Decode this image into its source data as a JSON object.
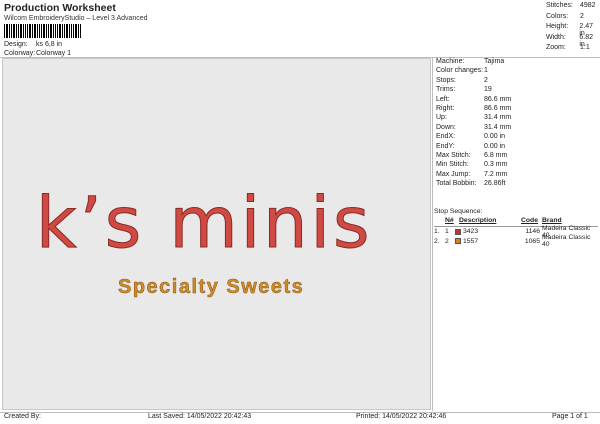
{
  "header": {
    "title": "Production Worksheet",
    "subtitle": "Wilcom EmbroideryStudio – Level 3 Advanced"
  },
  "design_info": {
    "design_label": "Design:",
    "design_value": "ks 6,8 in",
    "colorway_label": "Colorway:",
    "colorway_value": "Colorway 1"
  },
  "stats": [
    {
      "label": "Stitches:",
      "value": "4982"
    },
    {
      "label": "Colors:",
      "value": "2"
    },
    {
      "label": "Height:",
      "value": "2.47 in"
    },
    {
      "label": "Width:",
      "value": "6.82 in"
    },
    {
      "label": "Zoom:",
      "value": "1:1"
    }
  ],
  "machine": [
    {
      "label": "Machine:",
      "value": "Tajima"
    },
    {
      "label": "Color changes:",
      "value": "1"
    },
    {
      "label": "Stops:",
      "value": "2"
    },
    {
      "label": "Trims:",
      "value": "19"
    },
    {
      "label": "Left:",
      "value": "86.6 mm"
    },
    {
      "label": "Right:",
      "value": "86.6 mm"
    },
    {
      "label": "Up:",
      "value": "31.4 mm"
    },
    {
      "label": "Down:",
      "value": "31.4 mm"
    },
    {
      "label": "EndX:",
      "value": "0.00 in"
    },
    {
      "label": "EndY:",
      "value": "0.00 in"
    },
    {
      "label": "Max Stitch:",
      "value": "6.8 mm"
    },
    {
      "label": "Min Stitch:",
      "value": "0.3 mm"
    },
    {
      "label": "Max Jump:",
      "value": "7.2 mm"
    },
    {
      "label": "Total Bobbin:",
      "value": "26.86ft"
    }
  ],
  "stop_sequence": {
    "title": "Stop Sequence:",
    "headers": [
      "",
      "N#",
      "Description",
      "Code",
      "Brand"
    ],
    "rows": [
      {
        "stop": "1.",
        "n": "1",
        "color": "#c9302c",
        "description": "3423",
        "code": "1146",
        "brand": "Madeira Classic 40"
      },
      {
        "stop": "2.",
        "n": "2",
        "color": "#e07b1c",
        "description": "1557",
        "code": "1065",
        "brand": "Madeira Classic 40"
      }
    ]
  },
  "design": {
    "main_text": "k’s minis",
    "sub_text": "Specialty Sweets",
    "main_color": "#cf4a43",
    "sub_color": "#d08a2c"
  },
  "footer": {
    "created_by": "Created By:",
    "last_saved": "Last Saved: 14/05/2022 20:42:43",
    "printed": "Printed: 14/05/2022 20:42:46",
    "page": "Page 1 of 1"
  }
}
